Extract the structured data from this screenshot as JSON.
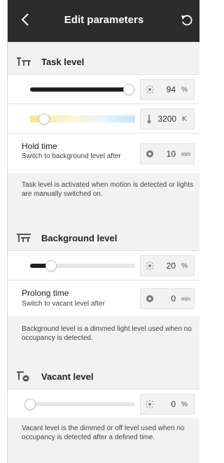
{
  "header": {
    "title": "Edit parameters",
    "back_icon": "chevron-left-icon",
    "undo_icon": "undo-icon"
  },
  "task": {
    "title": "Task level",
    "icon": "task-level-icon",
    "brightness": {
      "value": "94",
      "unit": "%",
      "level": 0.94,
      "icon": "brightness-icon"
    },
    "color_temp": {
      "value": "3200",
      "unit": "K",
      "icon": "thermometer-icon"
    },
    "hold_time": {
      "label": "Hold time",
      "sub": "Switch to background level after",
      "value": "10",
      "unit": "min",
      "icon": "timer-icon"
    },
    "description": "Task level is activated when motion is detected or lights are manually switched on."
  },
  "background": {
    "title": "Background level",
    "icon": "background-level-icon",
    "brightness": {
      "value": "20",
      "unit": "%",
      "level": 0.2,
      "icon": "brightness-icon"
    },
    "prolong_time": {
      "label": "Prolong time",
      "sub": "Switch to vacant level after",
      "value": "0",
      "unit": "min",
      "icon": "timer-icon"
    },
    "description": "Background level is a dimmed light level used when no occupancy is detected."
  },
  "vacant": {
    "title": "Vacant level",
    "icon": "vacant-level-icon",
    "brightness": {
      "value": "0",
      "unit": "%",
      "level": 0.0,
      "icon": "brightness-icon"
    },
    "description": "Vacant level is the dimmed or off level used when no occupancy is detected after a defined time."
  },
  "colors": {
    "header_bg": "#2b2b2b",
    "page_bg": "#f2f2f2",
    "slider_fill": "#1f1f1f",
    "warm": "#f7e98a",
    "cool": "#bfe6f8"
  }
}
